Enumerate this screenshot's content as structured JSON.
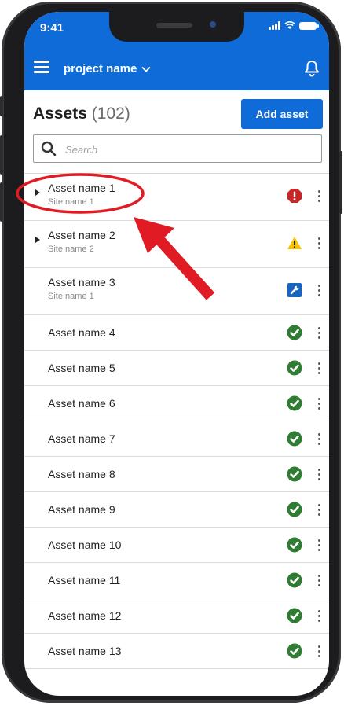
{
  "status_bar": {
    "time": "9:41"
  },
  "app_bar": {
    "project_name": "project name",
    "menu_icon": "hamburger-icon",
    "bell_icon": "bell-icon"
  },
  "header": {
    "title": "Assets",
    "count": "(102)",
    "add_button": "Add asset"
  },
  "search": {
    "placeholder": "Search",
    "value": ""
  },
  "colors": {
    "brand": "#0f6bd8",
    "error": "#c62828",
    "warning": "#f5c400",
    "maintenance": "#1565c0",
    "ok": "#2e7d32",
    "annotation": "#e01b24"
  },
  "assets": [
    {
      "name": "Asset name 1",
      "site": "Site name 1",
      "status": "error",
      "expandable": true
    },
    {
      "name": "Asset name 2",
      "site": "Site name 2",
      "status": "warning",
      "expandable": true
    },
    {
      "name": "Asset name 3",
      "site": "Site name 1",
      "status": "maintenance",
      "expandable": false
    },
    {
      "name": "Asset name 4",
      "status": "ok"
    },
    {
      "name": "Asset name 5",
      "status": "ok"
    },
    {
      "name": "Asset name 6",
      "status": "ok"
    },
    {
      "name": "Asset name 7",
      "status": "ok"
    },
    {
      "name": "Asset name 8",
      "status": "ok"
    },
    {
      "name": "Asset name 9",
      "status": "ok"
    },
    {
      "name": "Asset name 10",
      "status": "ok"
    },
    {
      "name": "Asset name 11",
      "status": "ok"
    },
    {
      "name": "Asset name 12",
      "status": "ok"
    },
    {
      "name": "Asset name 13",
      "status": "ok"
    }
  ]
}
